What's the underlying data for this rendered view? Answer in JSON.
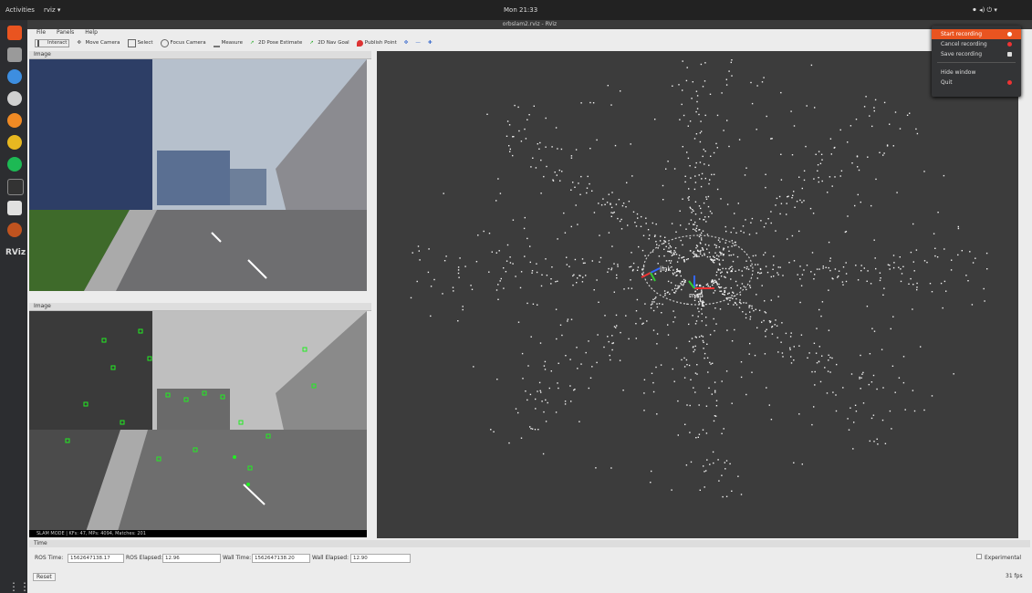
{
  "topbar": {
    "activities": "Activities",
    "app_menu": "rviz ▾",
    "clock": "Mon 21:33",
    "status_icons": "⚫ ◂) ⏻ ▾"
  },
  "window": {
    "title": "orbslam2.rviz - RViz"
  },
  "menubar": {
    "items": [
      "File",
      "Panels",
      "Help"
    ]
  },
  "toolbar": {
    "tools": [
      {
        "label": "Interact",
        "icon": "cursor-icon"
      },
      {
        "label": "Move Camera",
        "icon": "move-icon"
      },
      {
        "label": "Select",
        "icon": "select-icon"
      },
      {
        "label": "Focus Camera",
        "icon": "focus-icon"
      },
      {
        "label": "Measure",
        "icon": "ruler-icon"
      },
      {
        "label": "2D Pose Estimate",
        "icon": "arrow-green-icon"
      },
      {
        "label": "2D Nav Goal",
        "icon": "arrow-green-icon"
      },
      {
        "label": "Publish Point",
        "icon": "pin-icon"
      }
    ],
    "extra": [
      "✥",
      "—",
      "✚"
    ]
  },
  "panels": {
    "image_top_title": "Image",
    "image_bottom_title": "Image",
    "slam_status": "SLAM MODE  |  KFs: 47, MPs: 4094, Matches: 201"
  },
  "view3d": {
    "frame_link": "link",
    "frame_map": "map"
  },
  "time": {
    "title": "Time",
    "ros_time_label": "ROS Time:",
    "ros_time_value": "1562647138.17",
    "ros_elapsed_label": "ROS Elapsed:",
    "ros_elapsed_value": "12.96",
    "wall_time_label": "Wall Time:",
    "wall_time_value": "1562647138.20",
    "wall_elapsed_label": "Wall Elapsed:",
    "wall_elapsed_value": "12.90",
    "experimental_label": "Experimental",
    "reset_label": "Reset",
    "fps": "31 fps"
  },
  "popup_menu": {
    "items": [
      {
        "label": "Start recording",
        "active": true
      },
      {
        "label": "Cancel recording"
      },
      {
        "label": "Save recording"
      },
      {
        "label": "Hide window"
      },
      {
        "label": "Quit"
      }
    ]
  },
  "dock": {
    "rviz_label": "RViz"
  },
  "colors": {
    "accent": "#e95420",
    "background3d": "#3c3c3c",
    "feature": "#22ee22"
  }
}
